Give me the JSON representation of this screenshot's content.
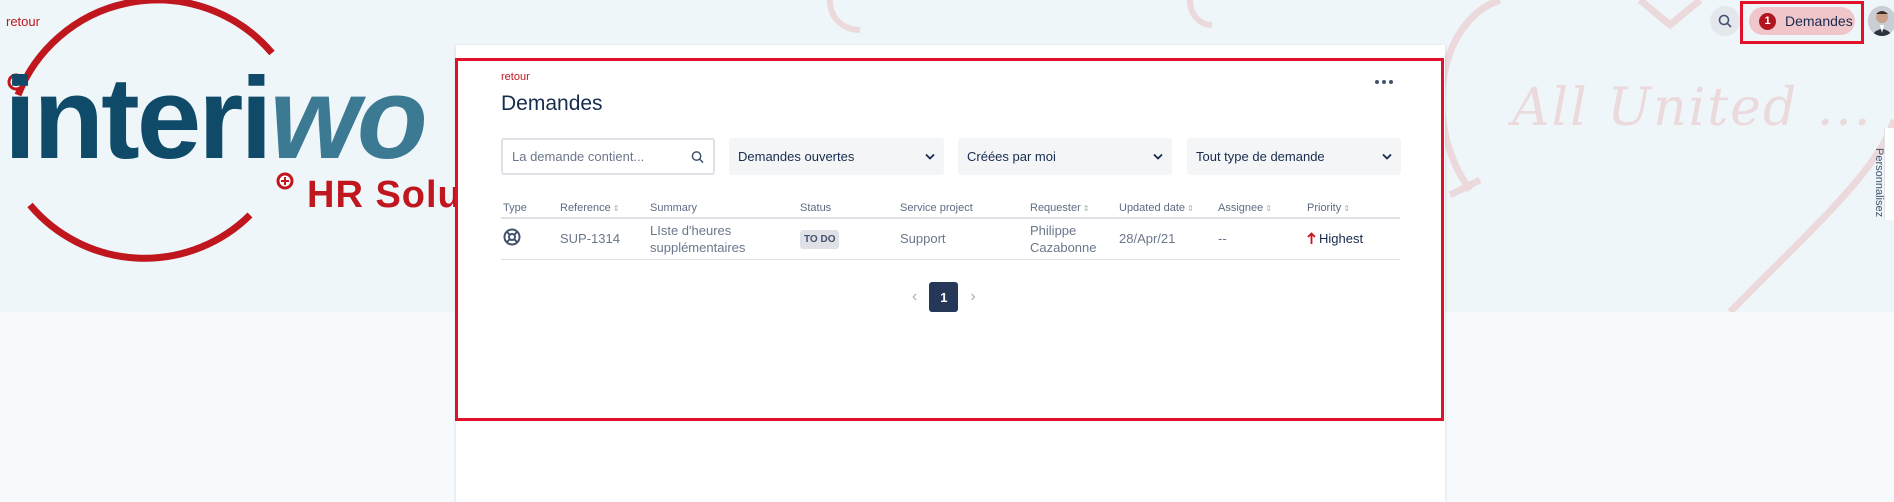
{
  "banner": {
    "back_label": "retour",
    "logo_part1": "interi",
    "logo_part2": "wo",
    "logo_sub": "HR Solu",
    "slogan": "All United ..."
  },
  "right_tab": {
    "label": "Personnalisez"
  },
  "nav": {
    "search_icon": "search-icon",
    "requests_label": "Demandes",
    "requests_count": "1"
  },
  "card": {
    "back_label": "retour",
    "title": "Demandes",
    "search_placeholder": "La demande contient...",
    "filters": {
      "status": "Demandes ouvertes",
      "created": "Créées par moi",
      "type": "Tout type de demande"
    }
  },
  "table": {
    "headers": [
      "Type",
      "Reference",
      "Summary",
      "Status",
      "Service project",
      "Requester",
      "Updated date",
      "Assignee",
      "Priority"
    ],
    "rows": [
      {
        "type_icon": "lifebuoy-icon",
        "reference": "SUP-1314",
        "summary": "LIste d'heures supplémentaires",
        "status": "TO DO",
        "service_project": "Support",
        "requester": "Philippe Cazabonne",
        "updated": "28/Apr/21",
        "assignee": "--",
        "priority": "Highest"
      }
    ]
  },
  "pagination": {
    "current": "1"
  },
  "colors": {
    "accent_red": "#c0161e",
    "highlight_outline": "#e0112b",
    "logo_blue": "#0f4a69",
    "page_active": "#253858"
  }
}
